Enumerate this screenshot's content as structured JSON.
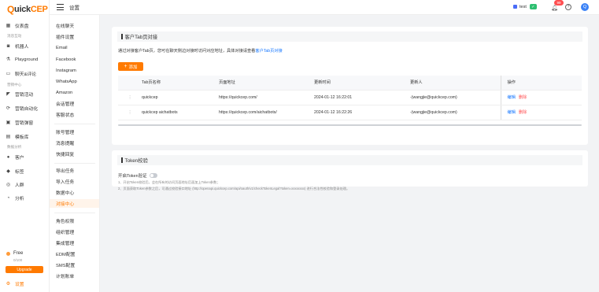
{
  "brand": {
    "logo_q": "Q",
    "logo_rest_pre": "uick",
    "logo_cep": "CEP"
  },
  "sidebar": {
    "items": [
      {
        "key": "dashboard",
        "label": "仪表盘",
        "icon": "dashboard-icon"
      },
      {
        "key": "robot",
        "label": "机器人",
        "icon": "robot-icon"
      },
      {
        "key": "playground",
        "label": "Playground",
        "icon": "flask-icon"
      },
      {
        "key": "chat",
        "label": "聊天&评论",
        "icon": "chat-icon"
      },
      {
        "key": "activity",
        "label": "营销活动",
        "icon": "megaphone-icon"
      },
      {
        "key": "automation",
        "label": "营销自动化",
        "icon": "automation-icon"
      },
      {
        "key": "channel",
        "label": "营销弹窗",
        "icon": "popup-icon"
      },
      {
        "key": "templates",
        "label": "模板库",
        "icon": "template-icon"
      },
      {
        "key": "customers",
        "label": "客户",
        "icon": "user-icon"
      },
      {
        "key": "tags",
        "label": "标签",
        "icon": "tag-icon"
      },
      {
        "key": "segments",
        "label": "人群",
        "icon": "people-icon"
      },
      {
        "key": "analysis",
        "label": "分析",
        "icon": "analytics-icon"
      }
    ],
    "groups": [
      "消息互动",
      "营销中心",
      "数据分析"
    ],
    "plan": {
      "name": "Free",
      "sub": "0/100",
      "upgrade_label": "Upgrade"
    },
    "settings_label": "设置"
  },
  "header": {
    "title": "设置",
    "user_name": "test",
    "badge_count": "99"
  },
  "submenu": {
    "items": [
      {
        "label": "在线聊天"
      },
      {
        "label": "插件设置"
      },
      {
        "label": "Email"
      },
      {
        "label": "Facebook"
      },
      {
        "label": "Instagram"
      },
      {
        "label": "WhatsApp"
      },
      {
        "label": "Amazon"
      },
      {
        "label": "会话管理"
      },
      {
        "label": "客服状态"
      },
      {
        "label": "账号管理"
      },
      {
        "label": "消息提醒"
      },
      {
        "label": "快捷回复"
      },
      {
        "label": "导出任务"
      },
      {
        "label": "导入任务"
      },
      {
        "label": "数据中心"
      },
      {
        "label": "对接中心"
      },
      {
        "label": "角色权限"
      },
      {
        "label": "组织管理"
      },
      {
        "label": "集成管理"
      },
      {
        "label": "EDM配置"
      },
      {
        "label": "SMS配置"
      },
      {
        "label": "计划账单"
      }
    ],
    "active_index": 15
  },
  "card1": {
    "title": "客户Tab页对接",
    "desc_prefix": "通过对接客户Tab页，您可在聊天侧边对接时访问对应地址，具体对接请查看",
    "desc_link": "客户Tab页对接",
    "add_label": "添加",
    "columns": [
      "Tab页名称",
      "页面地址",
      "更新时间",
      "更新人",
      "操作"
    ],
    "rows": [
      {
        "name": "quickcep",
        "url": "https://quickcep.com/",
        "time": "2024-01-12 16:22:01",
        "user": "-(wangjie@quickcep.com)"
      },
      {
        "name": "quickcep aichatbots",
        "url": "https://quickcep.com/aichatbots/",
        "time": "2024-01-12 16:22:26",
        "user": "-(wangjie@quickcep.com)"
      }
    ],
    "edit_label": "编辑",
    "delete_label": "删除"
  },
  "card2": {
    "title": "Token校验",
    "toggle_label": "开启Token验证",
    "notes": [
      "1、开启Token校验后，会在所有的访问页面地址后面加上Token参数；",
      "2、页面获取Token参数之后，可通过校验接口地址 (http://openapi.quickcep.com/api/oauth/v1/checkTokenLegal?token=xxxxxxxx) 进行合法性校验和登录处理。"
    ]
  }
}
